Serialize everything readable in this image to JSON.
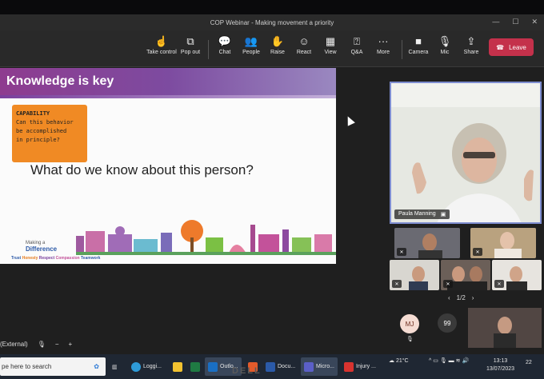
{
  "window": {
    "title": "COP Webinar - Making movement a priority"
  },
  "toolbar": {
    "take_control": "Take control",
    "pop_out": "Pop out",
    "chat": "Chat",
    "people": "People",
    "raise": "Raise",
    "react": "React",
    "view": "View",
    "qa": "Q&A",
    "more": "More",
    "camera": "Camera",
    "mic": "Mic",
    "share": "Share",
    "leave": "Leave"
  },
  "slide": {
    "title": "Knowledge is key",
    "note_heading": "CAPABILITY",
    "note_lines": [
      "Can this behavior",
      "be accomplished",
      "in principle?"
    ],
    "question": "What do we know about this person?",
    "logo_top": "Making a",
    "logo_main": "Difference",
    "values": [
      "Trust",
      "Honesty",
      "Respect",
      "Compassion",
      "Teamwork"
    ]
  },
  "presenter": {
    "name": "Paula Manning"
  },
  "gallery": {
    "pager": "1/2"
  },
  "others": {
    "avatar_initials": "MJ",
    "count": "99"
  },
  "external_label": "(External)",
  "taskbar": {
    "search_placeholder": "pe here to search",
    "apps": [
      "Loggi...",
      "Outlo...",
      "Docu...",
      "Micro...",
      "Injury ..."
    ],
    "temperature": "21°C",
    "time": "13:13",
    "date": "13/07/2023",
    "notifications": "22"
  },
  "colors": {
    "leave": "#c4314b",
    "slide_header": "#8e3c8f",
    "note": "#f08a24",
    "presenter_border": "#7d8ccf"
  }
}
